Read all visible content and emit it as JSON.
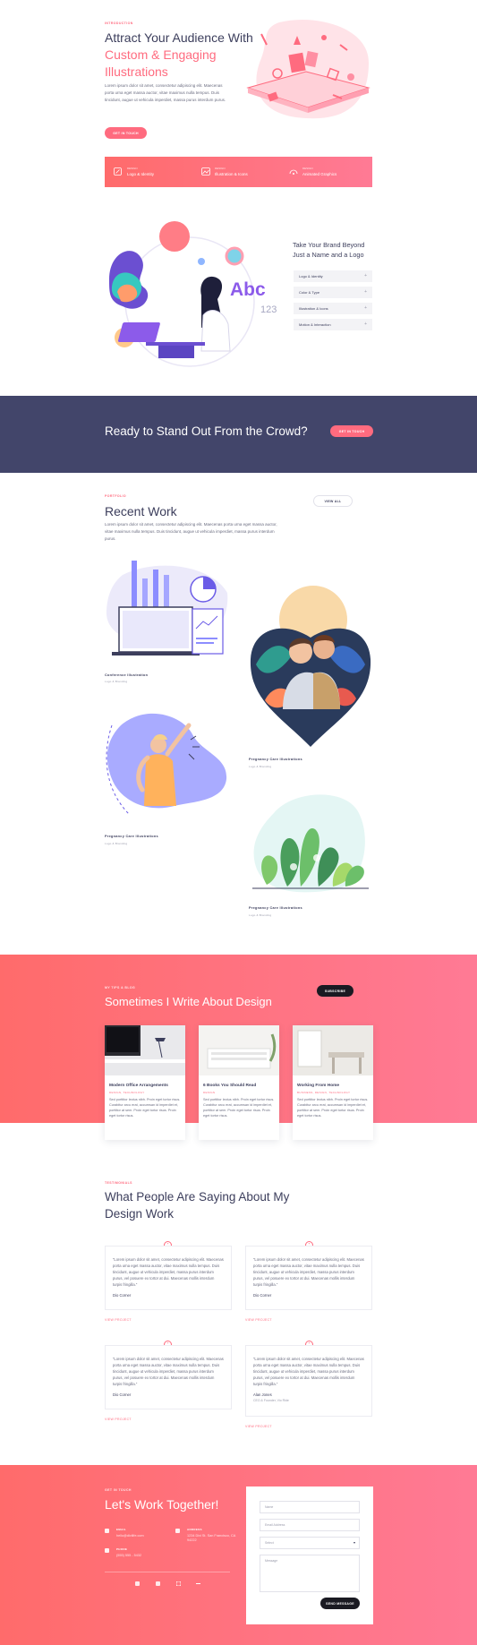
{
  "hero": {
    "eyebrow": "Introduction",
    "title_line1": "Attract Your Audience With",
    "title_line2": "Custom & Engaging",
    "title_line3": "Illustrations",
    "body": "Lorem ipsum dolor sit amet, consectetur adipiscing elit. Maecenas porta urna eget massa auctor, vitae maximus nulla tempus. Duis tincidunt, augue ut vehicula imperdiet, massa purus interdum purus.",
    "cta": "Get In Touch"
  },
  "services_bar": {
    "items": [
      {
        "small": "Design",
        "label": "Logo & Identity",
        "icon": "pen-icon"
      },
      {
        "small": "Design",
        "label": "Illustration & Icons",
        "icon": "image-icon"
      },
      {
        "small": "Design",
        "label": "Animated Graphics",
        "icon": "motion-icon"
      }
    ]
  },
  "brand": {
    "title": "Take Your Brand Beyond Just a Name and a Logo",
    "abc": "Abc",
    "num": "123",
    "accordion": [
      {
        "label": "Logo & Identity"
      },
      {
        "label": "Color & Type"
      },
      {
        "label": "Illustration & Icons"
      },
      {
        "label": "Motion & Interaction"
      }
    ],
    "plus": "+"
  },
  "cta_band": {
    "title": "Ready to Stand Out From the Crowd?",
    "button": "Get In Touch"
  },
  "portfolio": {
    "eyebrow": "Portfolio",
    "title": "Recent Work",
    "body": "Lorem ipsum dolor sit amet, consectetur adipiscing elit. Maecenas porta urna eget massa auctor, vitae maximus nulla tempus. Duis tincidunt, augue ut vehicula imperdiet, massa purus interdum purus.",
    "view_all": "View All",
    "items": [
      {
        "title": "Conference Illustration",
        "sub": "Logo & Branding"
      },
      {
        "title": "Pregnancy Care Illustrations",
        "sub": "Logo & Branding"
      },
      {
        "title": "Pregnancy Care Illustrations",
        "sub": "Logo & Branding"
      },
      {
        "title": "Pregnancy Care Illustrations",
        "sub": "Logo & Branding"
      }
    ]
  },
  "blog": {
    "eyebrow": "My Tips & Blog",
    "title": "Sometimes I Write About Design",
    "button": "Subscribe",
    "posts": [
      {
        "title": "Modern Office Arrangements",
        "cat": "Design, Technology",
        "excerpt": "Sed porttitor lectus nibh. Proin eget tortor risus. Curabitur arcu erat, accumsan id imperdiet et, porttitor at sem. Proin eget tortor risus. Proin eget tortor risus."
      },
      {
        "title": "6 Books You Should Read",
        "cat": "Design",
        "excerpt": "Sed porttitor lectus nibh. Proin eget tortor risus. Curabitur arcu erat, accumsan id imperdiet et, porttitor at sem. Proin eget tortor risus. Proin eget tortor risus."
      },
      {
        "title": "Working From Home",
        "cat": "Business, Design, Technology",
        "excerpt": "Sed porttitor lectus nibh. Proin eget tortor risus. Curabitur arcu erat, accumsan id imperdiet et, porttitor at sem. Proin eget tortor risus. Proin eget tortor risus."
      }
    ]
  },
  "testimonials": {
    "eyebrow": "Testimonials",
    "title_line1": "What People Are Saying About My",
    "title_line2": "Design Work",
    "quote_mark": "”",
    "view_link": "View Project",
    "items": [
      {
        "quote": "“Lorem ipsum dolor sit amet, consectetur adipiscing elit. Maecenas porta urna eget massa auctor, vitae maximus nulla tempus. Duis tincidunt, augue ut vehicula imperdiet, massa purus interdum purus, vel posuere ex tortor at dui. Maecenas mollis interdum turpis fringilla.”",
        "name": "Dio Corner",
        "role": ""
      },
      {
        "quote": "“Lorem ipsum dolor sit amet, consectetur adipiscing elit. Maecenas porta urna eget massa auctor, vitae maximus nulla tempus. Duis tincidunt, augue ut vehicula imperdiet, massa purus interdum purus, vel posuere ex tortor at dui. Maecenas mollis interdum turpis fringilla.”",
        "name": "Dio Corner",
        "role": ""
      },
      {
        "quote": "“Lorem ipsum dolor sit amet, consectetur adipiscing elit. Maecenas porta urna eget massa auctor, vitae maximus nulla tempus. Duis tincidunt, augue ut vehicula imperdiet, massa purus interdum purus, vel posuere ex tortor at dui. Maecenas mollis interdum turpis fringilla.”",
        "name": "Dio Corner",
        "role": ""
      },
      {
        "quote": "“Lorem ipsum dolor sit amet, consectetur adipiscing elit. Maecenas porta urna eget massa auctor, vitae maximus nulla tempus. Duis tincidunt, augue ut vehicula imperdiet, massa purus interdum purus, vel posuere ex tortor at dui. Maecenas mollis interdum turpis fringilla.”",
        "name": "Alan Jones",
        "role": "CEO & Founder, Vio Ride"
      }
    ]
  },
  "contact": {
    "eyebrow": "Get In Touch",
    "title": "Let's Work Together!",
    "email_label": "Email",
    "email": "hello@divilife.com",
    "address_label": "Address",
    "address": "1234 Divi St. San Francisco, CA 94222",
    "phone_label": "Phone",
    "phone": "(555) 555 - 5432",
    "form": {
      "name": "Name",
      "email": "Email Address",
      "select": "Select",
      "message": "Message",
      "submit": "Send Message"
    },
    "social": [
      "facebook-icon",
      "twitter-icon",
      "instagram-icon",
      "linkedin-icon"
    ]
  },
  "colors": {
    "accent": "#ff6b7f",
    "navy": "#3c3e5c",
    "band": "#42456a"
  }
}
